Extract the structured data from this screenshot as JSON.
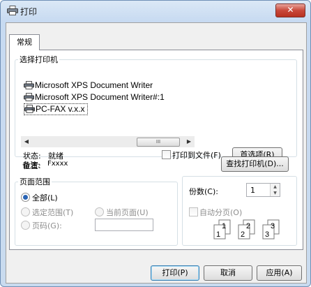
{
  "window": {
    "title": "打印",
    "close_glyph": "✕",
    "icon": "printer-icon"
  },
  "tabs": [
    {
      "label": "常规",
      "active": true
    }
  ],
  "printer_group": {
    "legend": "选择打印机",
    "printers": [
      {
        "name": "Microsoft XPS Document Writer",
        "icon": "printer-icon",
        "selected": false
      },
      {
        "name": "Microsoft XPS Document Writer#:1",
        "icon": "printer-icon",
        "selected": false
      },
      {
        "name": "PC-FAX v.x.x",
        "icon": "fax-icon",
        "selected": true
      }
    ],
    "scrollbar": {
      "left_arrow": "◀",
      "right_arrow": "▶",
      "thumb_grip": "III"
    },
    "status_label": "状态:",
    "status_value": "就绪",
    "location_label": "位置:",
    "location_value": "",
    "comment_label": "备注:",
    "comment_value": "Fxxxx",
    "print_to_file_label": "打印到文件(F)",
    "print_to_file_checked": false,
    "preferences_button": "首选项(R)",
    "find_printer_button": "查找打印机(D)..."
  },
  "page_range_group": {
    "legend": "页面范围",
    "options": [
      {
        "label": "全部(L)",
        "checked": true,
        "enabled": true
      },
      {
        "label": "选定范围(T)",
        "checked": false,
        "enabled": false
      },
      {
        "label": "当前页面(U)",
        "checked": false,
        "enabled": false
      },
      {
        "label": "页码(G):",
        "checked": false,
        "enabled": false
      }
    ],
    "pages_value": ""
  },
  "copies_group": {
    "copies_label": "份数(C):",
    "copies_value": "1",
    "collate_label": "自动分页(O)",
    "collate_checked": false,
    "collate_icon": "collate-icon",
    "collate_pages": [
      {
        "back": "1",
        "front": "1"
      },
      {
        "back": "2",
        "front": "2"
      },
      {
        "back": "3",
        "front": "3"
      }
    ]
  },
  "footer": {
    "print_button": "打印(P)",
    "cancel_button": "取消",
    "apply_button": "应用(A)"
  }
}
